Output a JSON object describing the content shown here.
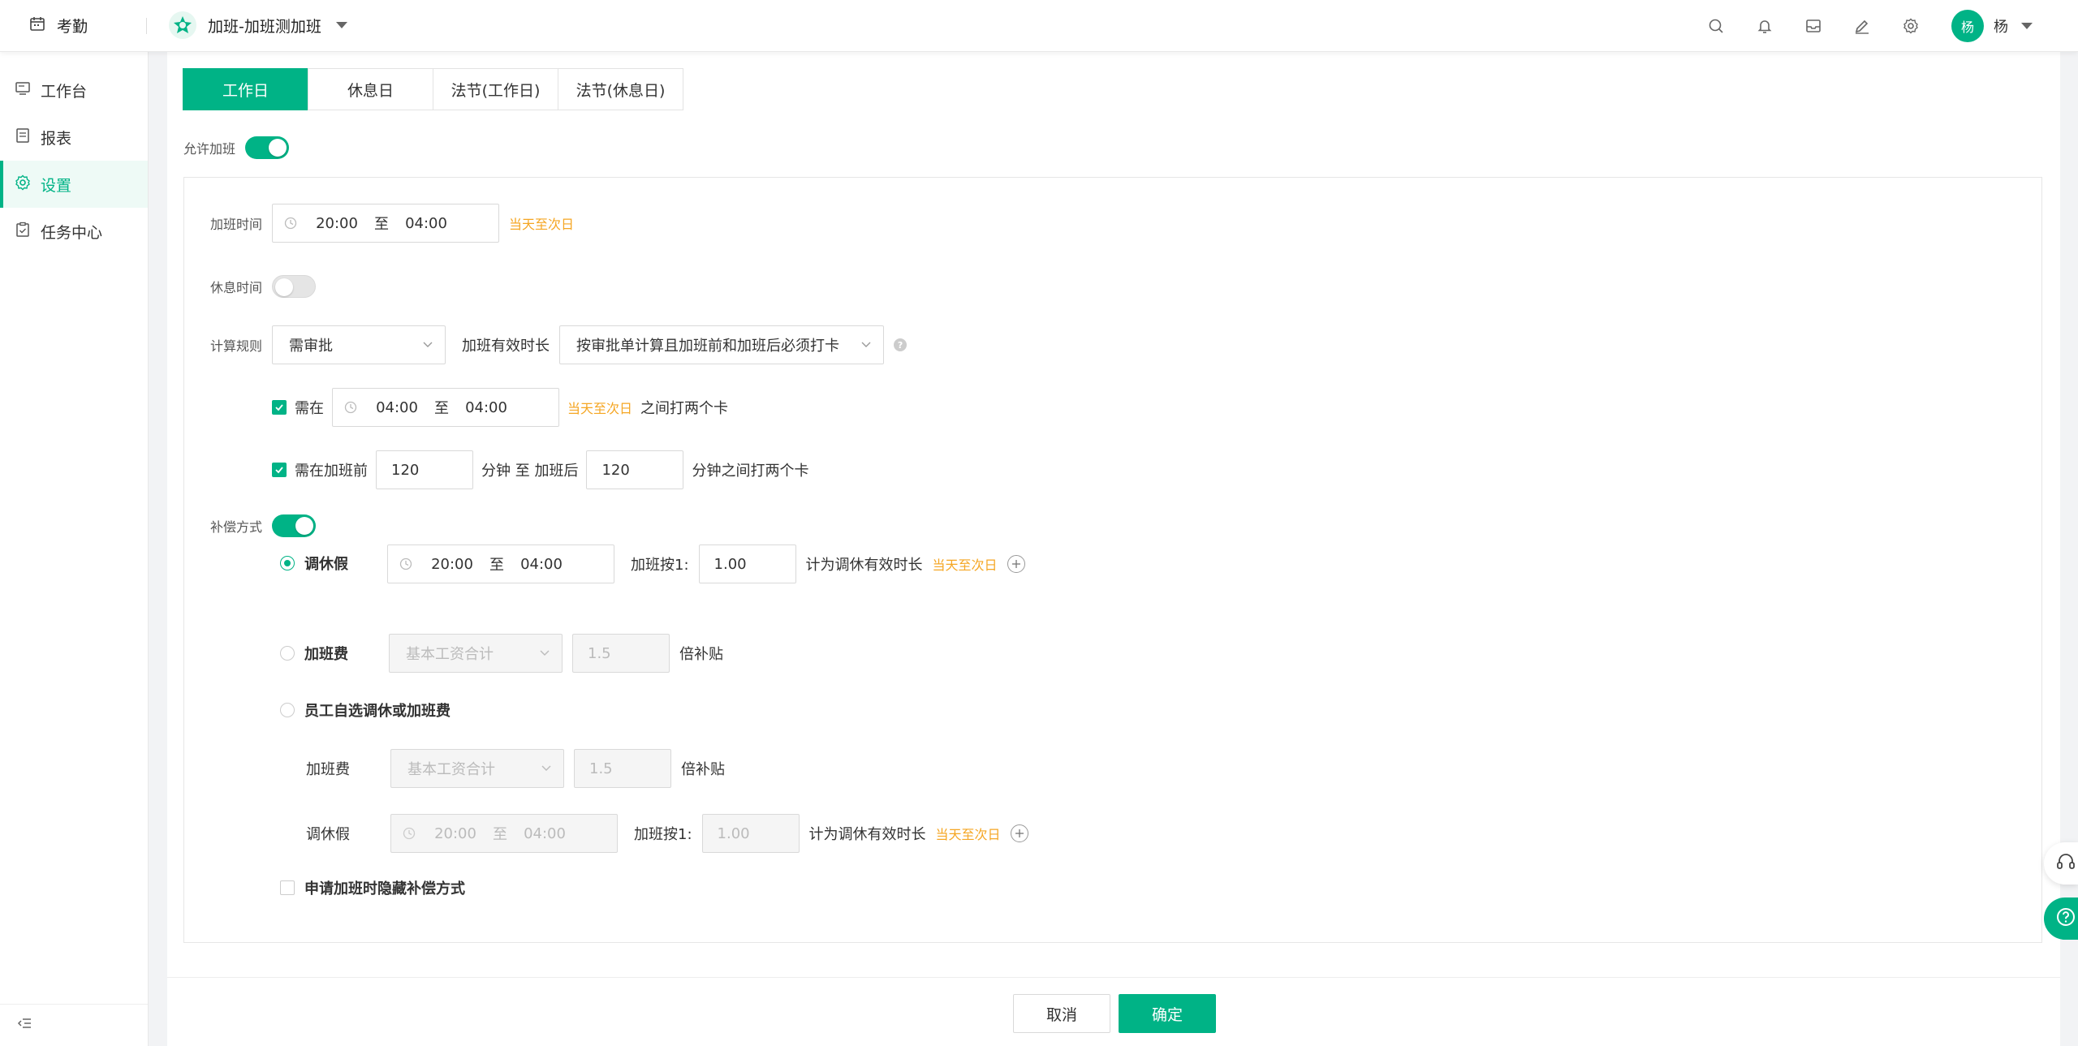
{
  "topbar": {
    "app_name": "考勤",
    "group_name": "加班-加班测加班",
    "user_initial": "杨",
    "user_name": "杨"
  },
  "sidebar": {
    "items": [
      {
        "label": "工作台",
        "icon": "monitor-icon"
      },
      {
        "label": "报表",
        "icon": "report-icon"
      },
      {
        "label": "设置",
        "icon": "gear-icon",
        "active": true
      },
      {
        "label": "任务中心",
        "icon": "task-icon"
      }
    ]
  },
  "tabs": [
    "工作日",
    "休息日",
    "法节(工作日)",
    "法节(休息日)"
  ],
  "allow_overtime": {
    "label": "允许加班",
    "on": true
  },
  "overtime_time": {
    "label": "加班时间",
    "start": "20:00",
    "sep": "至",
    "end": "04:00",
    "hint": "当天至次日"
  },
  "rest_time": {
    "label": "休息时间",
    "on": false
  },
  "calc_rule": {
    "label": "计算规则",
    "value": "需审批",
    "duration_label": "加班有效时长",
    "duration_value": "按审批单计算且加班前和加班后必须打卡"
  },
  "punch_rule1": {
    "label": "需在",
    "start": "04:00",
    "sep": "至",
    "end": "04:00",
    "hint": "当天至次日",
    "suffix": "之间打两个卡"
  },
  "punch_rule2": {
    "label": "需在加班前",
    "before": "120",
    "mid": "分钟 至 加班后",
    "after": "120",
    "suffix": "分钟之间打两个卡"
  },
  "compensation": {
    "label": "补偿方式",
    "on": true,
    "leave": {
      "label": "调休假",
      "start": "20:00",
      "sep": "至",
      "end": "04:00",
      "ratio_label": "加班按1:",
      "ratio": "1.00",
      "suffix": "计为调休有效时长",
      "hint": "当天至次日"
    },
    "fee": {
      "label": "加班费",
      "select": "基本工资合计",
      "multiplier": "1.5",
      "suffix": "倍补贴"
    },
    "choice": {
      "label": "员工自选调休或加班费"
    },
    "choice_fee": {
      "label": "加班费",
      "select": "基本工资合计",
      "multiplier": "1.5",
      "suffix": "倍补贴"
    },
    "choice_leave": {
      "label": "调休假",
      "start": "20:00",
      "sep": "至",
      "end": "04:00",
      "ratio_label": "加班按1:",
      "ratio": "1.00",
      "suffix": "计为调休有效时长",
      "hint": "当天至次日"
    },
    "hide": {
      "label": "申请加班时隐藏补偿方式"
    }
  },
  "footer": {
    "cancel": "取消",
    "ok": "确定"
  },
  "colors": {
    "accent": "#00b386",
    "hint": "#f5a623"
  }
}
